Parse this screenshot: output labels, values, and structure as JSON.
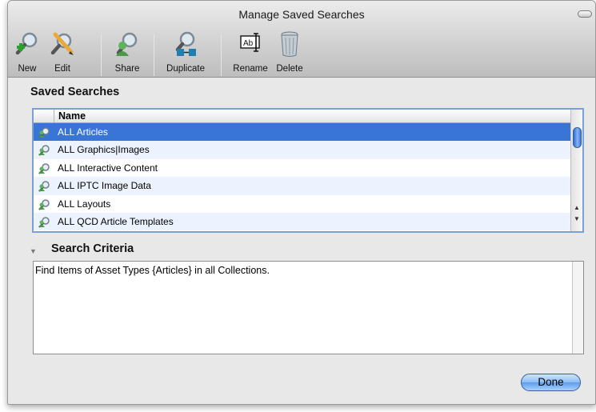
{
  "window": {
    "title": "Manage Saved Searches"
  },
  "toolbar": {
    "items": [
      {
        "label": "New",
        "icon": "new-search-icon"
      },
      {
        "label": "Edit",
        "icon": "edit-search-icon"
      },
      {
        "label": "Share",
        "icon": "share-icon"
      },
      {
        "label": "Duplicate",
        "icon": "duplicate-icon"
      },
      {
        "label": "Rename",
        "icon": "rename-icon"
      },
      {
        "label": "Delete",
        "icon": "trash-icon"
      }
    ]
  },
  "saved_searches": {
    "heading": "Saved Searches",
    "column_name": "Name",
    "items": [
      "ALL Articles",
      "ALL Graphics|Images",
      "ALL Interactive Content",
      "ALL IPTC Image Data",
      "ALL Layouts",
      "ALL QCD Article Templates"
    ]
  },
  "criteria": {
    "heading": "Search Criteria",
    "text": "Find Items of Asset Types {Articles} in all Collections."
  },
  "buttons": {
    "done": "Done"
  },
  "colors": {
    "selection": "#3875d7",
    "alt_row": "#edf3fe",
    "focus_ring": "#7ba0d6"
  }
}
